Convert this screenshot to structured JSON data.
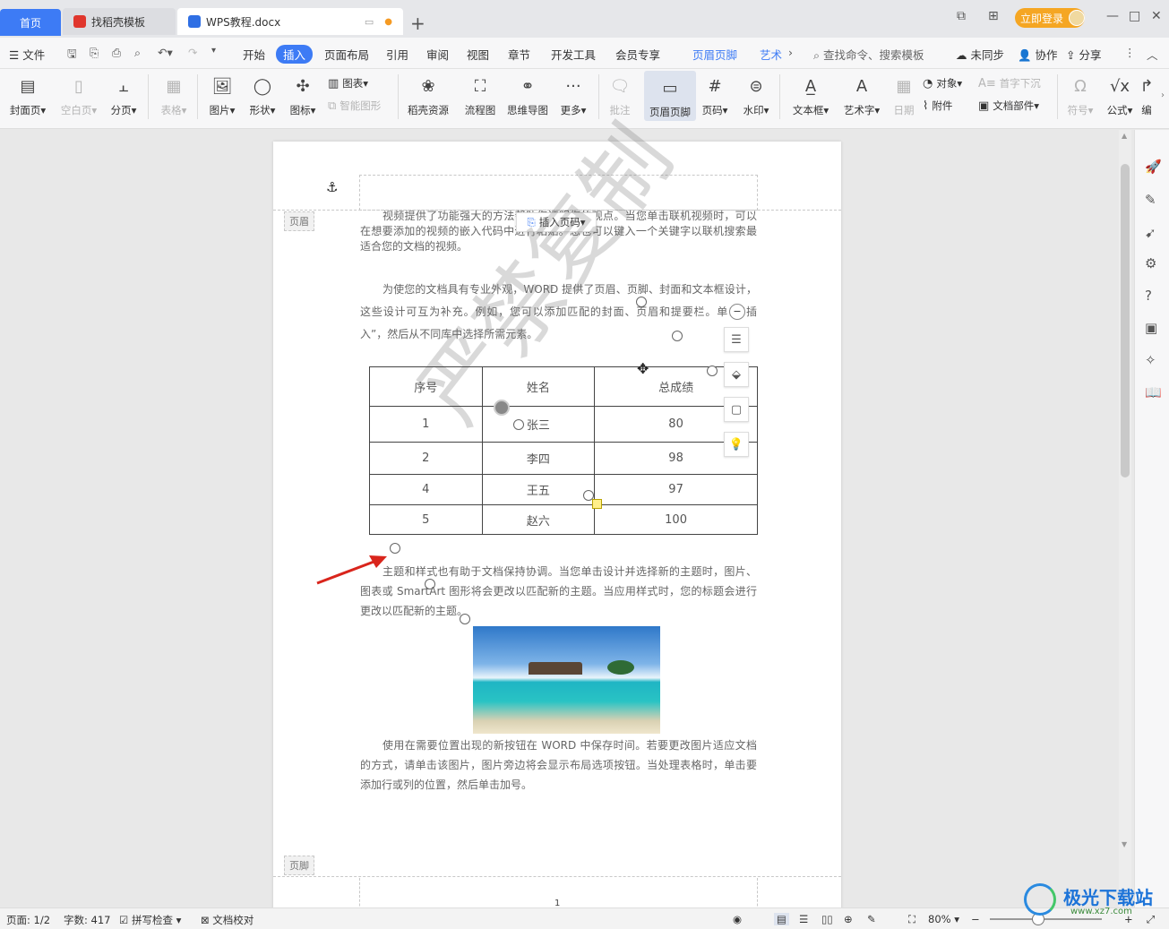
{
  "tabs": {
    "home": "首页",
    "template": "找稻壳模板",
    "doc": "WPS教程.docx",
    "new_tab": "+"
  },
  "titlebar": {
    "login": "立即登录"
  },
  "menu": {
    "file": "文件",
    "items": [
      "开始",
      "插入",
      "页面布局",
      "引用",
      "审阅",
      "视图",
      "章节",
      "开发工具",
      "会员专享",
      "页眉页脚",
      "艺术"
    ],
    "active": "插入",
    "search": "查找命令、搜索模板",
    "unsynced": "未同步",
    "collab": "协作",
    "share": "分享"
  },
  "ribbon": {
    "cover": "封面页",
    "blank": "空白页",
    "pagebreak": "分页",
    "table": "表格",
    "picture": "图片",
    "shape": "形状",
    "icon": "图标",
    "chart": "图表",
    "smart": "智能图形",
    "docer": "稻壳资源",
    "flow": "流程图",
    "mindmap": "思维导图",
    "more": "更多",
    "comment": "批注",
    "headerfooter": "页眉页脚",
    "pagenum": "页码",
    "watermark": "水印",
    "textbox": "文本框",
    "arttext": "艺术字",
    "date": "日期",
    "object": "对象",
    "attach": "附件",
    "dropcap": "首字下沉",
    "docpart": "文档部件",
    "symbol": "符号",
    "formula": "公式",
    "edit": "编"
  },
  "document": {
    "header_tag": "页眉",
    "footer_tag": "页脚",
    "insert_pagenum": "插入页码",
    "p1": "视频提供了功能强大的方法帮助您证明您的观点。当您单击联机视频时，可以在想要添加的视频的嵌入代码中进行粘贴。您也可以键入一个关键字以联机搜索最适合您的文档的视频。",
    "p2": "为使您的文档具有专业外观，WORD 提供了页眉、页脚、封面和文本框设计，这些设计可互为补充。例如，您可以添加匹配的封面、页眉和提要栏。单击“插入”，然后从不同库中选择所需元素。",
    "table_headers": [
      "序号",
      "姓名",
      "总成绩"
    ],
    "table_rows": [
      [
        "1",
        "张三",
        "80"
      ],
      [
        "2",
        "李四",
        "98"
      ],
      [
        "4",
        "王五",
        "97"
      ],
      [
        "5",
        "赵六",
        "100"
      ]
    ],
    "watermark": "严禁复制",
    "p3": "主题和样式也有助于文档保持协调。当您单击设计并选择新的主题时，图片、图表或 SmartArt 图形将会更改以匹配新的主题。当应用样式时，您的标题会进行更改以匹配新的主题。",
    "p4": "使用在需要位置出现的新按钮在 WORD 中保存时间。若要更改图片适应文档的方式，请单击该图片，图片旁边将会显示布局选项按钮。当处理表格时，单击要添加行或列的位置，然后单击加号。",
    "footer_page": "1"
  },
  "status": {
    "page": "页面: 1/2",
    "words": "字数: 417",
    "spell": "拼写检查",
    "proof": "文档校对",
    "zoom": "80%"
  },
  "brand": {
    "logo_text": "极光下载站",
    "logo_url_text": "www.xz7.com"
  },
  "colors": {
    "accent": "#3d7bf5",
    "login": "#f5a623",
    "arrow": "#d9251c"
  }
}
